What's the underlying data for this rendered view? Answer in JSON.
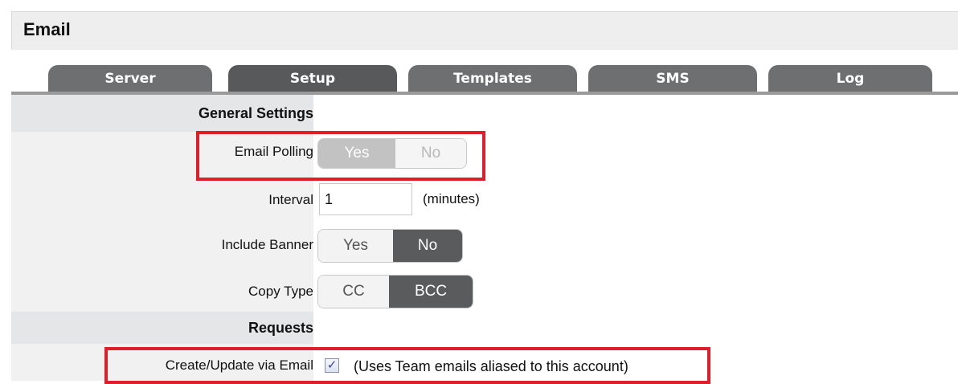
{
  "page": {
    "title": "Email"
  },
  "tabs": [
    {
      "label": "Server",
      "active": false
    },
    {
      "label": "Setup",
      "active": true
    },
    {
      "label": "Templates",
      "active": false
    },
    {
      "label": "SMS",
      "active": false
    },
    {
      "label": "Log",
      "active": false
    }
  ],
  "general_settings": {
    "heading": "General Settings",
    "email_polling": {
      "label": "Email Polling",
      "yes": "Yes",
      "no": "No",
      "selected": "Yes",
      "disabled": true
    },
    "interval": {
      "label": "Interval",
      "value": "1",
      "unit": "(minutes)"
    },
    "include_banner": {
      "label": "Include Banner",
      "yes": "Yes",
      "no": "No",
      "selected": "No"
    },
    "copy_type": {
      "label": "Copy Type",
      "cc": "CC",
      "bcc": "BCC",
      "selected": "BCC"
    }
  },
  "requests": {
    "heading": "Requests",
    "create_update": {
      "label": "Create/Update via Email",
      "checked": true,
      "note": "(Uses Team emails aliased to this account)"
    }
  },
  "colors": {
    "highlight": "#e01e2b",
    "tab": "#6d6f70",
    "active_tab": "#58595b",
    "toggle_on": "#5a5b5d"
  },
  "icons": {
    "checkbox_checked": "checkmark-icon"
  }
}
